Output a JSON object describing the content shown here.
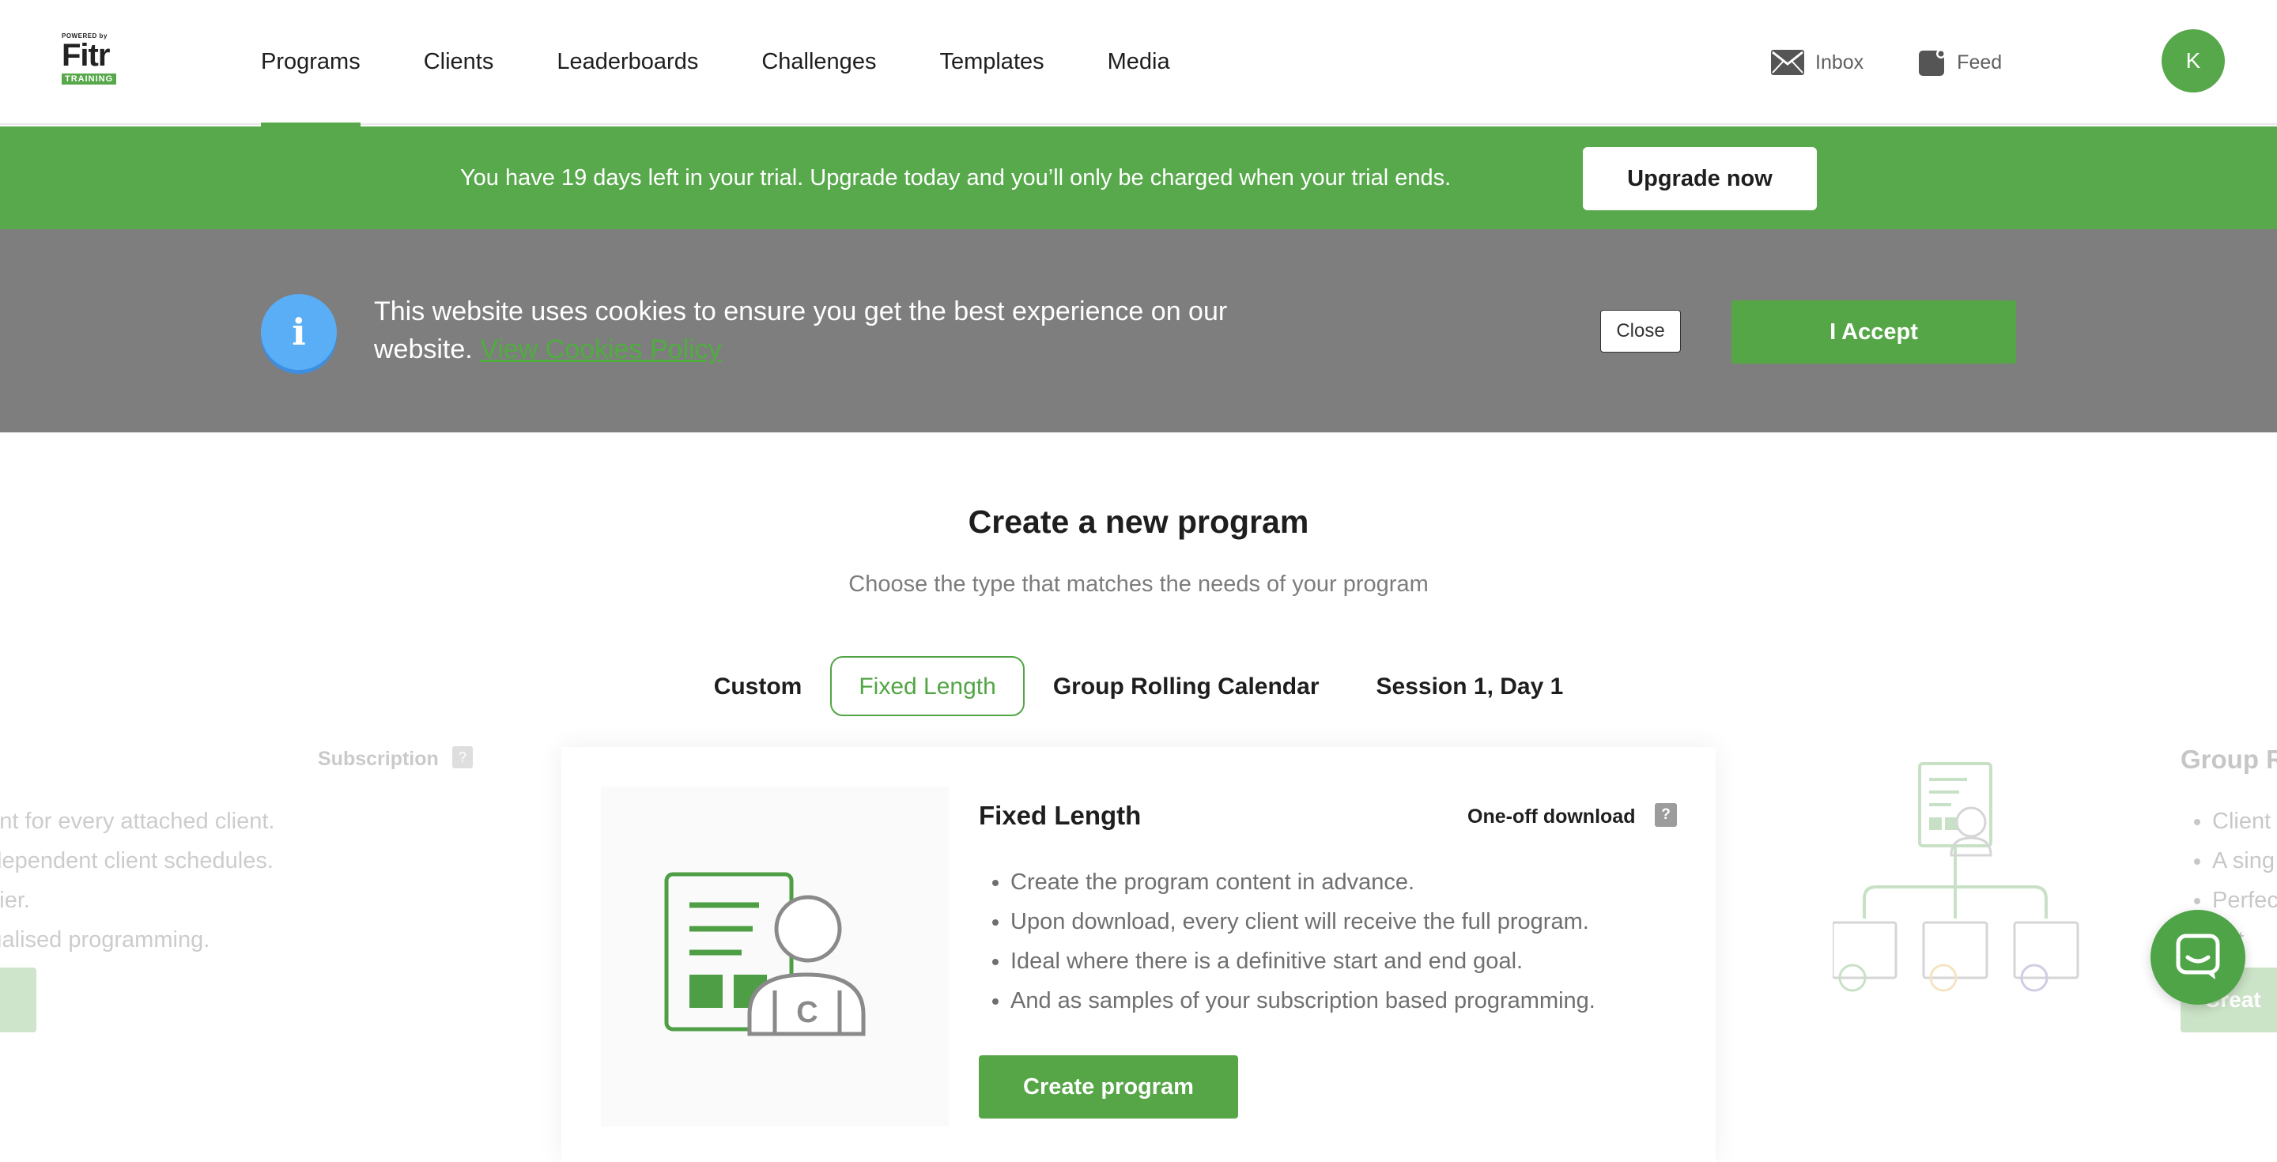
{
  "logo": {
    "powered": "POWERED by",
    "brand": "Fitr",
    "tagline": "TRAINING"
  },
  "nav": {
    "items": [
      {
        "label": "Programs",
        "active": true
      },
      {
        "label": "Clients"
      },
      {
        "label": "Leaderboards"
      },
      {
        "label": "Challenges"
      },
      {
        "label": "Templates"
      },
      {
        "label": "Media"
      }
    ],
    "inbox_label": "Inbox",
    "feed_label": "Feed",
    "avatar_initial": "K"
  },
  "trial_banner": {
    "message": "You have 19 days left in your trial. Upgrade today and you’ll only be charged when your trial ends.",
    "button": "Upgrade now"
  },
  "cookie_banner": {
    "info_glyph": "i",
    "text": "This website uses cookies to ensure you get the best experience on our website.",
    "link": "View Cookies Policy",
    "close": "Close",
    "accept": "I Accept"
  },
  "main": {
    "title": "Create a new program",
    "subtitle": "Choose the type that matches the needs of your program",
    "tabs": [
      {
        "label": "Custom"
      },
      {
        "label": "Fixed Length",
        "active": true
      },
      {
        "label": "Group Rolling Calendar"
      },
      {
        "label": "Session 1, Day 1"
      }
    ],
    "left_ghost": {
      "badge": "Subscription",
      "lines": [
        "am content for every attached client.",
        "ultiple independent client schedules.",
        "r pricing tier.",
        "e/individualised programming."
      ]
    },
    "right_ghost": {
      "title": "Group R",
      "lines": [
        "Client",
        "A sing",
        "Perfec",
        "eat"
      ],
      "button": "Creat"
    },
    "card": {
      "title": "Fixed Length",
      "badge": "One-off download",
      "help_glyph": "?",
      "features": [
        "Create the program content in advance.",
        "Upon download, every client will receive the full program.",
        "Ideal where there is a definitive start and end goal.",
        "And as samples of your subscription based programming."
      ],
      "button": "Create program"
    }
  },
  "colors": {
    "brand_green": "#56a84a",
    "cookie_bg": "#7e7e7e",
    "info_blue": "#5aaef5"
  }
}
